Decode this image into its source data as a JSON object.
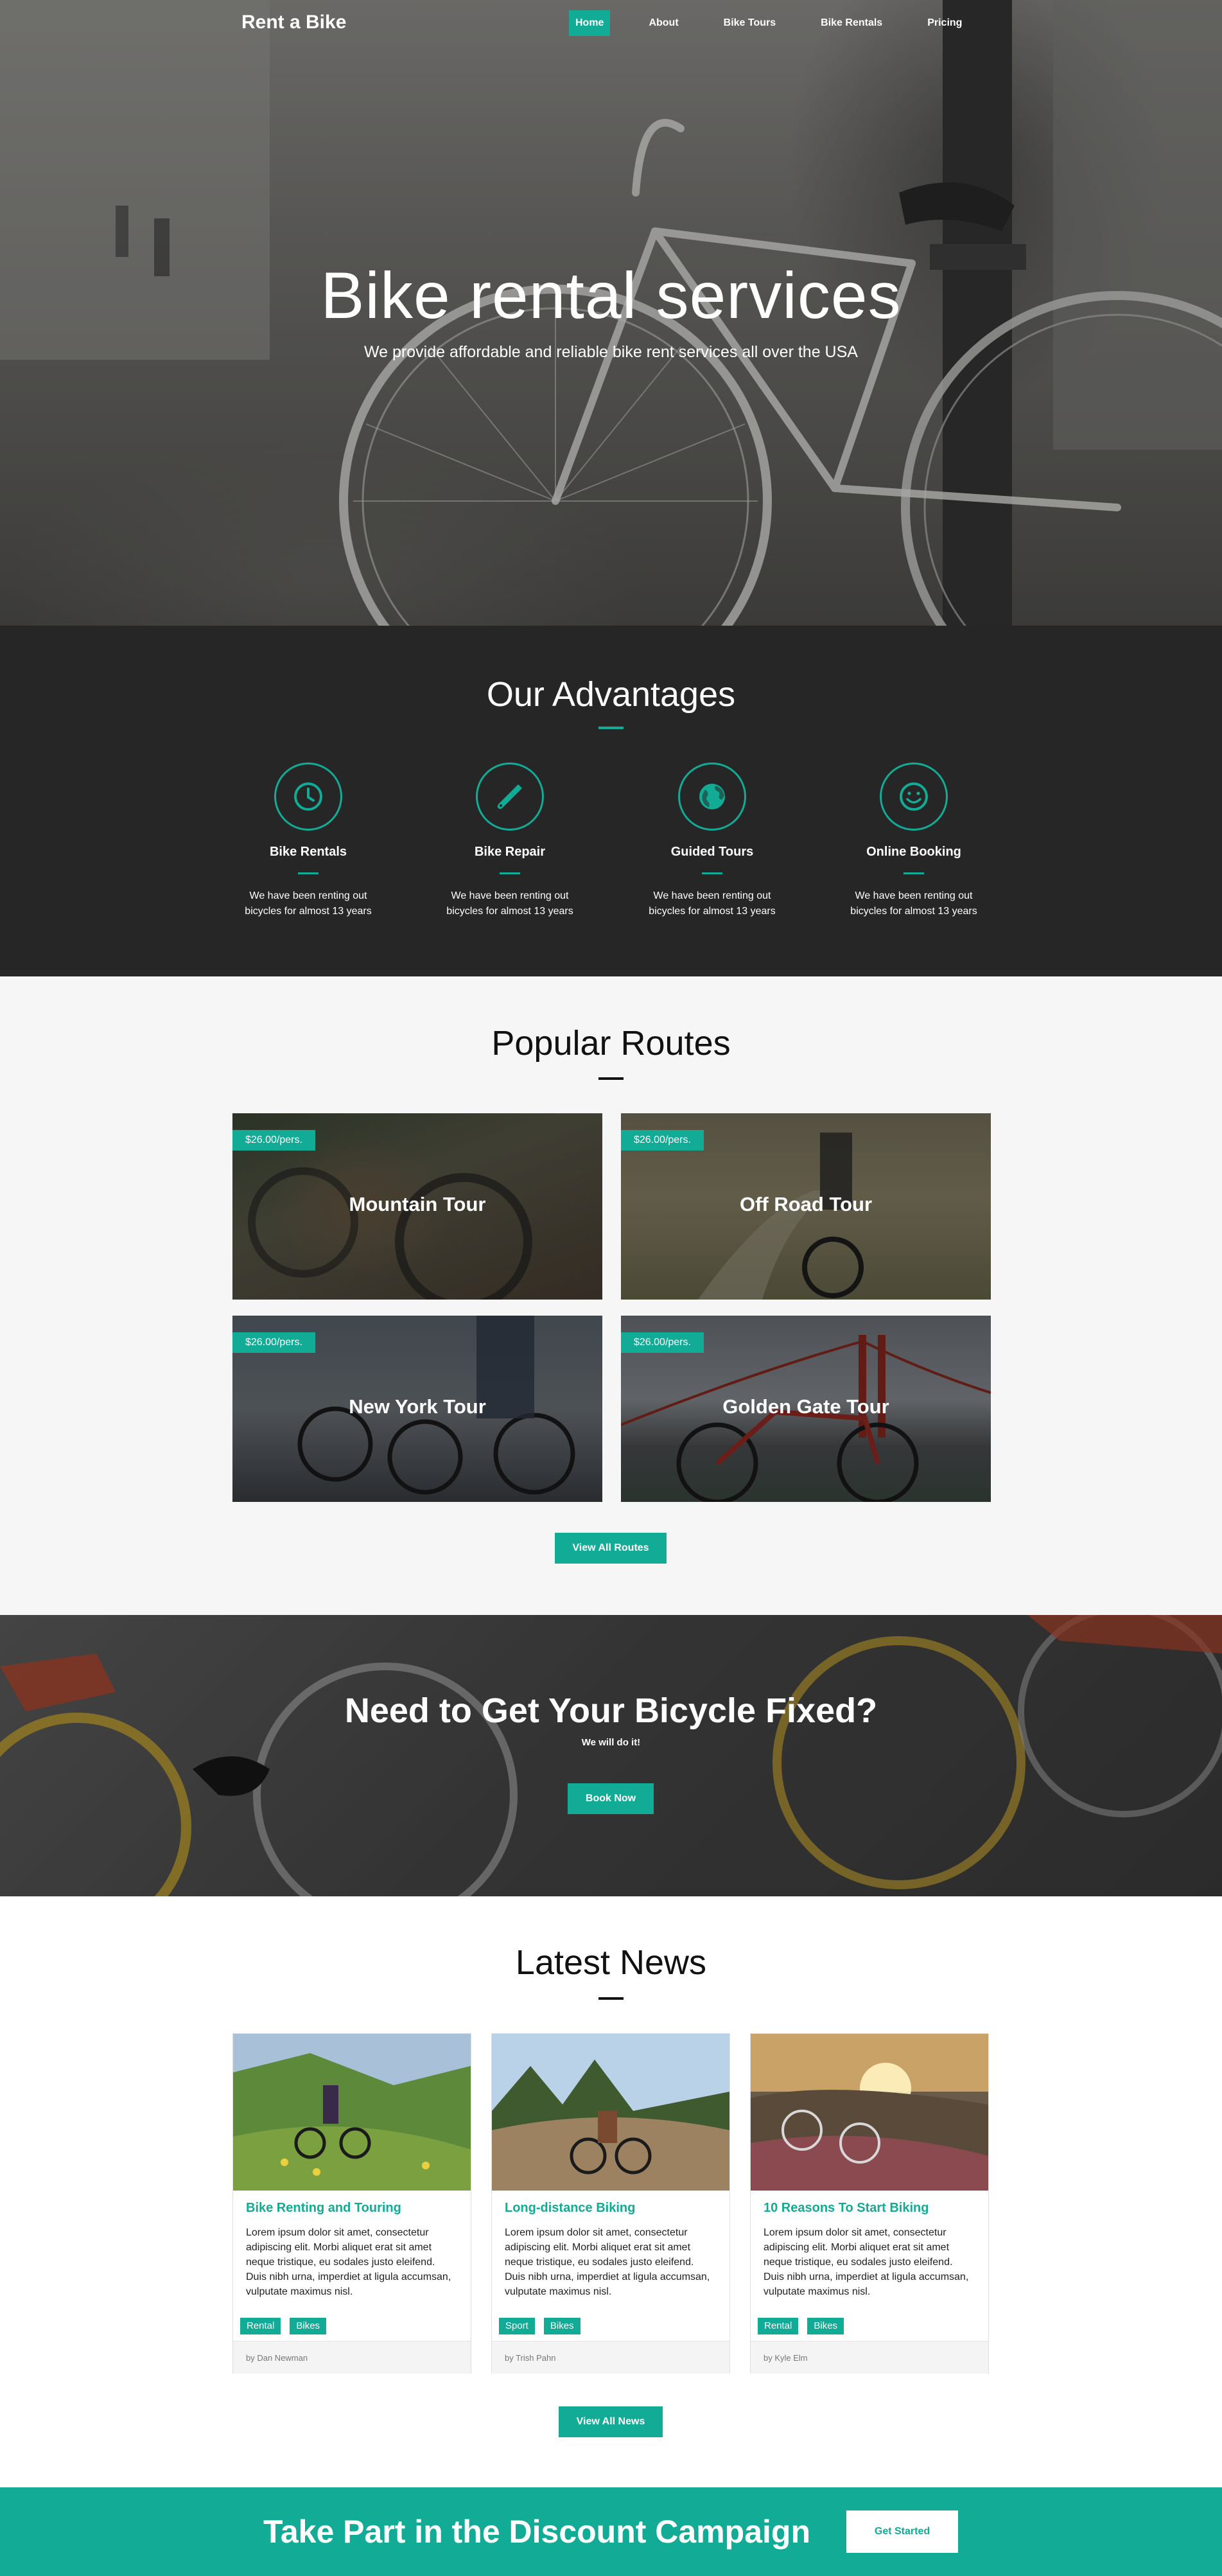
{
  "brand": "Rent a Bike",
  "nav": [
    {
      "label": "Home",
      "active": true
    },
    {
      "label": "About"
    },
    {
      "label": "Bike Tours"
    },
    {
      "label": "Bike Rentals"
    },
    {
      "label": "Pricing"
    }
  ],
  "hero": {
    "title": "Bike rental services",
    "subtitle": "We provide affordable and reliable bike rent services all over the USA"
  },
  "advantages": {
    "title": "Our Advantages",
    "items": [
      {
        "icon": "clock-icon",
        "name": "Bike Rentals",
        "text": "We have been renting out bicycles for almost 13 years"
      },
      {
        "icon": "wrench-icon",
        "name": "Bike Repair",
        "text": "We have been renting out bicycles for almost 13 years"
      },
      {
        "icon": "globe-icon",
        "name": "Guided Tours",
        "text": "We have been renting out bicycles for almost 13 years"
      },
      {
        "icon": "smiley-icon",
        "name": "Online Booking",
        "text": "We have been renting out bicycles for almost 13 years"
      }
    ]
  },
  "routes": {
    "title": "Popular Routes",
    "items": [
      {
        "price": "$26.00/pers.",
        "name": "Mountain Tour"
      },
      {
        "price": "$26.00/pers.",
        "name": "Off Road Tour"
      },
      {
        "price": "$26.00/pers.",
        "name": "New York Tour"
      },
      {
        "price": "$26.00/pers.",
        "name": "Golden Gate Tour"
      }
    ],
    "button": "View All Routes"
  },
  "fix": {
    "title": "Need to Get Your Bicycle Fixed?",
    "subtitle": "We will do it!",
    "button": "Book Now"
  },
  "news": {
    "title": "Latest News",
    "items": [
      {
        "title": "Bike Renting and Touring",
        "text": "Lorem ipsum dolor sit amet, consectetur adipiscing elit. Morbi aliquet erat sit amet neque tristique, eu sodales justo eleifend. Duis nibh urna, imperdiet at ligula accumsan, vulputate maximus nisl.",
        "tags": [
          "Rental",
          "Bikes"
        ],
        "author": "by Dan Newman"
      },
      {
        "title": "Long-distance Biking",
        "text": "Lorem ipsum dolor sit amet, consectetur adipiscing elit. Morbi aliquet erat sit amet neque tristique, eu sodales justo eleifend. Duis nibh urna, imperdiet at ligula accumsan, vulputate maximus nisl.",
        "tags": [
          "Sport",
          "Bikes"
        ],
        "author": "by Trish Pahn"
      },
      {
        "title": "10 Reasons To Start Biking",
        "text": "Lorem ipsum dolor sit amet, consectetur adipiscing elit. Morbi aliquet erat sit amet neque tristique, eu sodales justo eleifend. Duis nibh urna, imperdiet at ligula accumsan, vulputate maximus nisl.",
        "tags": [
          "Rental",
          "Bikes"
        ],
        "author": "by Kyle Elm"
      }
    ],
    "button": "View All News"
  },
  "campaign": {
    "title": "Take Part in the Discount Campaign",
    "button": "Get Started"
  },
  "colors": {
    "accent": "#12ab95",
    "dark": "#262626",
    "light_bg": "#f6f6f6"
  }
}
